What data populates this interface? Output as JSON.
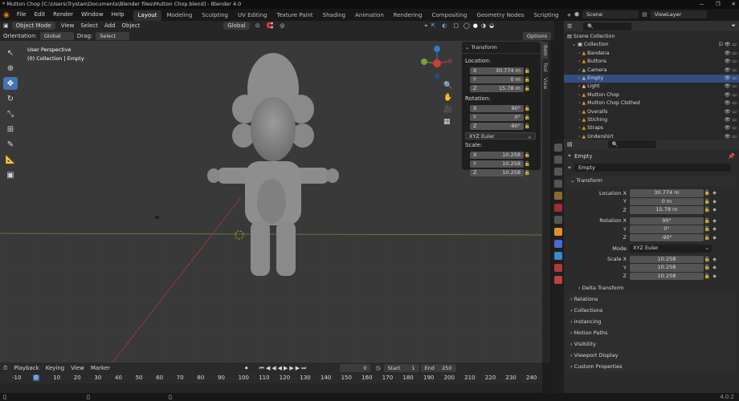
{
  "window": {
    "title": "* Mutton Chop [C:\\Users\\Trystan\\Documents\\Blender files\\Mutton Chop.blend] - Blender 4.0"
  },
  "menu": {
    "items": [
      "File",
      "Edit",
      "Render",
      "Window",
      "Help"
    ]
  },
  "workspaces": [
    "Layout",
    "Modeling",
    "Sculpting",
    "UV Editing",
    "Texture Paint",
    "Shading",
    "Animation",
    "Rendering",
    "Compositing",
    "Geometry Nodes",
    "Scripting"
  ],
  "scene": {
    "name": "Scene",
    "view_layer": "ViewLayer"
  },
  "viewport_header": {
    "mode": "Object Mode",
    "view": "View",
    "select": "Select",
    "add": "Add",
    "object": "Object",
    "transform_space": "Global"
  },
  "viewport_header2": {
    "orientation_label": "Orientation:",
    "orientation": "Global",
    "drag_label": "Drag:",
    "drag": "Select Box",
    "options": "Options"
  },
  "viewport": {
    "perspective": "User Perspective",
    "collection_info": "(0) Collection | Empty"
  },
  "npanel": {
    "title": "Transform",
    "location_label": "Location:",
    "loc": [
      {
        "axis": "X",
        "value": "30.774 m"
      },
      {
        "axis": "Y",
        "value": "0 m"
      },
      {
        "axis": "Z",
        "value": "15.78 m"
      }
    ],
    "rotation_label": "Rotation:",
    "rot": [
      {
        "axis": "X",
        "value": "90°"
      },
      {
        "axis": "Y",
        "value": "0°"
      },
      {
        "axis": "Z",
        "value": "-90°"
      }
    ],
    "mode": "XYZ Euler",
    "scale_label": "Scale:",
    "scale": [
      {
        "axis": "X",
        "value": "10.258"
      },
      {
        "axis": "Y",
        "value": "10.258"
      },
      {
        "axis": "Z",
        "value": "10.258"
      }
    ]
  },
  "sidetabs": [
    "Item",
    "Tool",
    "View"
  ],
  "outliner": {
    "root": "Scene Collection",
    "collection": "Collection",
    "items": [
      {
        "name": "Bandana",
        "selected": false
      },
      {
        "name": "Buttons",
        "selected": false
      },
      {
        "name": "Camera",
        "selected": false
      },
      {
        "name": "Empty",
        "selected": true
      },
      {
        "name": "Light",
        "selected": false
      },
      {
        "name": "Mutton Chop",
        "selected": false
      },
      {
        "name": "Mutton Chop Clothed",
        "selected": false
      },
      {
        "name": "Overalls",
        "selected": false
      },
      {
        "name": "Stiching",
        "selected": false
      },
      {
        "name": "Straps",
        "selected": false
      },
      {
        "name": "Undershirt",
        "selected": false
      }
    ]
  },
  "properties": {
    "object_name": "Empty",
    "object_field": "Empty",
    "transform_title": "Transform",
    "location": [
      {
        "label": "Location X",
        "value": "30.774 m"
      },
      {
        "label": "Y",
        "value": "0 m"
      },
      {
        "label": "Z",
        "value": "15.78 m"
      }
    ],
    "rotation": [
      {
        "label": "Rotation X",
        "value": "90°"
      },
      {
        "label": "Y",
        "value": "0°"
      },
      {
        "label": "Z",
        "value": "-90°"
      }
    ],
    "mode_label": "Mode",
    "mode": "XYZ Euler",
    "scale": [
      {
        "label": "Scale X",
        "value": "10.258"
      },
      {
        "label": "Y",
        "value": "10.258"
      },
      {
        "label": "Z",
        "value": "10.258"
      }
    ],
    "delta": "Delta Transform",
    "panels": [
      "Relations",
      "Collections",
      "Instancing",
      "Motion Paths",
      "Visibility",
      "Viewport Display",
      "Custom Properties"
    ]
  },
  "timeline": {
    "playback": "Playback",
    "keying": "Keying",
    "view": "View",
    "marker": "Marker",
    "current_frame": "0",
    "start_label": "Start",
    "start": "1",
    "end_label": "End",
    "end": "250",
    "ticks": [
      "-10",
      "0",
      "10",
      "20",
      "30",
      "40",
      "50",
      "60",
      "70",
      "80",
      "90",
      "100",
      "110",
      "120",
      "130",
      "140",
      "150",
      "160",
      "170",
      "180",
      "190",
      "200",
      "210",
      "220",
      "230",
      "240"
    ]
  },
  "version": "4.0.2"
}
